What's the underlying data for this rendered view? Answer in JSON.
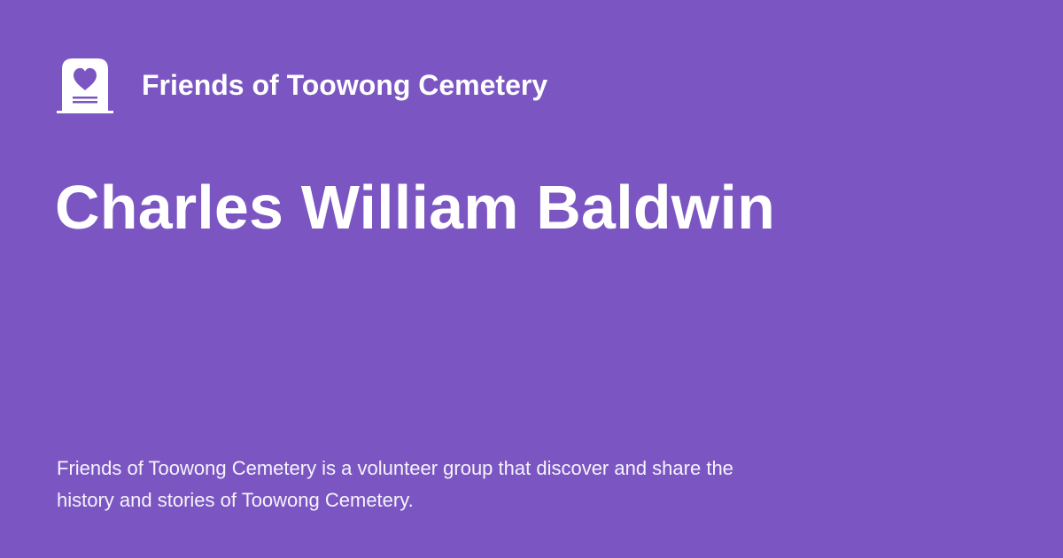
{
  "brand": {
    "logo_icon": "heart-headstone-icon",
    "name": "Friends of Toowong Cemetery"
  },
  "page": {
    "title": "Charles William Baldwin",
    "description": "Friends of Toowong Cemetery is a volunteer group that discover and share the history and stories of Toowong Cemetery."
  },
  "colors": {
    "background": "#7b56c2",
    "text": "#ffffff"
  }
}
